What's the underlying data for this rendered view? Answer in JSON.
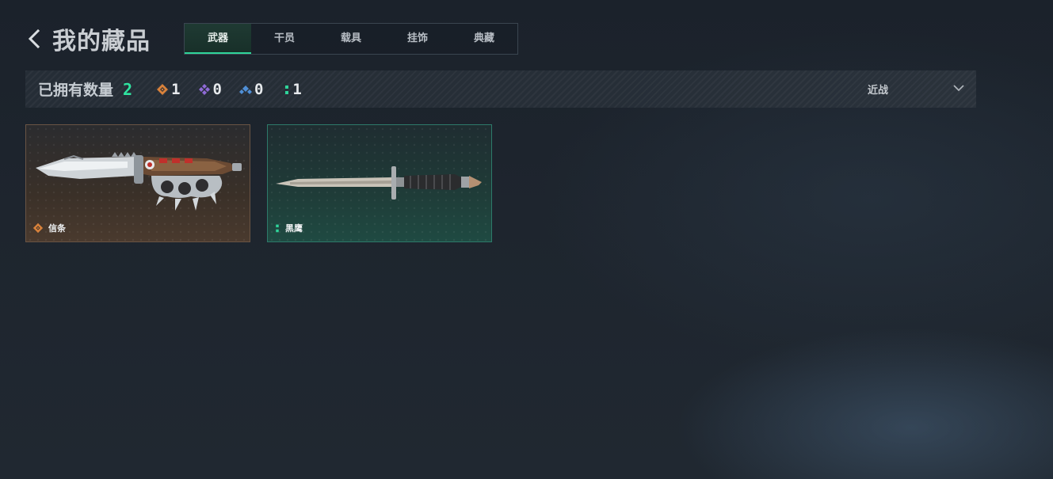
{
  "header": {
    "title": "我的藏品",
    "back_icon": "chevron-left-icon"
  },
  "tabs": [
    {
      "label": "武器",
      "active": true
    },
    {
      "label": "干员",
      "active": false
    },
    {
      "label": "载具",
      "active": false
    },
    {
      "label": "挂饰",
      "active": false
    },
    {
      "label": "典藏",
      "active": false
    }
  ],
  "summary": {
    "owned_label": "已拥有数量",
    "owned_count": "2",
    "rarities": [
      {
        "icon": "gold-diamond-icon",
        "count": "1",
        "color": "#d9823b"
      },
      {
        "icon": "purple-diamond-icon",
        "count": "0",
        "color": "#8f6ad6"
      },
      {
        "icon": "blue-chevron-icon",
        "count": "0",
        "color": "#4f8fd6"
      },
      {
        "icon": "green-dots-icon",
        "count": "1",
        "color": "#2fd49a"
      }
    ]
  },
  "filter": {
    "selected": "近战",
    "icon": "chevron-down-icon"
  },
  "items": [
    {
      "name": "信条",
      "rarity": "gold",
      "rarity_icon": "gold-diamond-icon",
      "image": "knuckle-knife-image"
    },
    {
      "name": "黑鹰",
      "rarity": "green",
      "rarity_icon": "green-dots-icon",
      "image": "dagger-image"
    }
  ],
  "colors": {
    "accent_green": "#2fe3a0",
    "gold_border": "#6a5444",
    "green_border": "#2d7a6a"
  }
}
